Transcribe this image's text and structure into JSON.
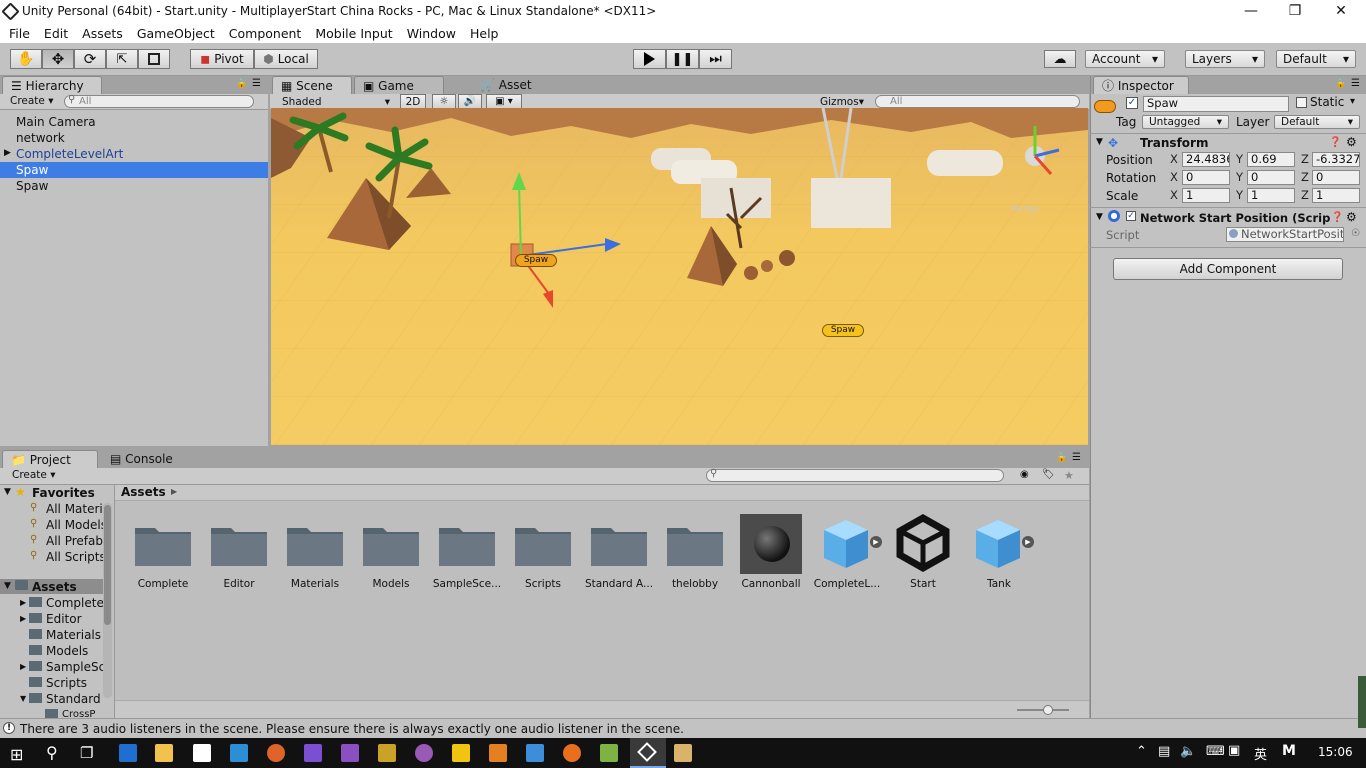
{
  "window": {
    "title": "Unity Personal (64bit) - Start.unity - MultiplayerStart China Rocks - PC, Mac & Linux Standalone* <DX11>"
  },
  "menubar": {
    "items": [
      "File",
      "Edit",
      "Assets",
      "GameObject",
      "Component",
      "Mobile Input",
      "Window",
      "Help"
    ]
  },
  "toolbar": {
    "pivot": "Pivot",
    "local": "Local",
    "account": "Account",
    "layers": "Layers",
    "layout": "Default"
  },
  "hierarchy": {
    "tab": "Hierarchy",
    "create": "Create",
    "search_placeholder": "All",
    "items": [
      "Main Camera",
      "network",
      "CompleteLevelArt",
      "Spaw",
      "Spaw"
    ]
  },
  "scene": {
    "tabs": [
      "Scene",
      "Game",
      "Asset Store"
    ],
    "shading": "Shaded",
    "mode2d": "2D",
    "gizmos": "Gizmos",
    "search_placeholder": "All",
    "labels": [
      "Spaw",
      "Spaw"
    ],
    "persp": "Persp"
  },
  "inspector": {
    "tab": "Inspector",
    "object_name": "Spaw",
    "static_label": "Static",
    "tag_label": "Tag",
    "tag_value": "Untagged",
    "layer_label": "Layer",
    "layer_value": "Default",
    "transform": {
      "title": "Transform",
      "position_label": "Position",
      "position": {
        "x": "24.4836",
        "y": "0.69",
        "z": "-6.3327"
      },
      "rotation_label": "Rotation",
      "rotation": {
        "x": "0",
        "y": "0",
        "z": "0"
      },
      "scale_label": "Scale",
      "scale": {
        "x": "1",
        "y": "1",
        "z": "1"
      }
    },
    "network_component": {
      "title": "Network Start Position (Scrip",
      "script_label": "Script",
      "script_value": "NetworkStartPosit"
    },
    "add_component": "Add Component",
    "axis_x": "X",
    "axis_y": "Y",
    "axis_z": "Z"
  },
  "project": {
    "tabs": [
      "Project",
      "Console"
    ],
    "create": "Create",
    "favorites_title": "Favorites",
    "favorites": [
      "All Materi",
      "All Models",
      "All Prefab",
      "All Scripts"
    ],
    "assets_title": "Assets",
    "assets_tree": [
      "Complete",
      "Editor",
      "Materials",
      "Models",
      "SampleSc",
      "Scripts",
      "Standard",
      "CrossP"
    ],
    "breadcrumb": "Assets",
    "assets": [
      {
        "label": "Complete",
        "kind": "folder"
      },
      {
        "label": "Editor",
        "kind": "folder"
      },
      {
        "label": "Materials",
        "kind": "folder"
      },
      {
        "label": "Models",
        "kind": "folder"
      },
      {
        "label": "SampleSce...",
        "kind": "folder"
      },
      {
        "label": "Scripts",
        "kind": "folder"
      },
      {
        "label": "Standard A...",
        "kind": "folder"
      },
      {
        "label": "thelobby",
        "kind": "folder"
      },
      {
        "label": "Cannonball",
        "kind": "material"
      },
      {
        "label": "CompleteL...",
        "kind": "prefab"
      },
      {
        "label": "Start",
        "kind": "scene"
      },
      {
        "label": "Tank",
        "kind": "prefab"
      }
    ]
  },
  "status": {
    "message": "There are 3 audio listeners in the scene. Please ensure there is always exactly one audio listener in the scene."
  },
  "taskbar": {
    "time": "15:06",
    "ime": "英",
    "ime2": "M"
  },
  "colors": {
    "selection": "#3e7ce6",
    "panel": "#c2c2c2",
    "scene_ground": "#f0c25e",
    "play_accent": "#000000"
  }
}
